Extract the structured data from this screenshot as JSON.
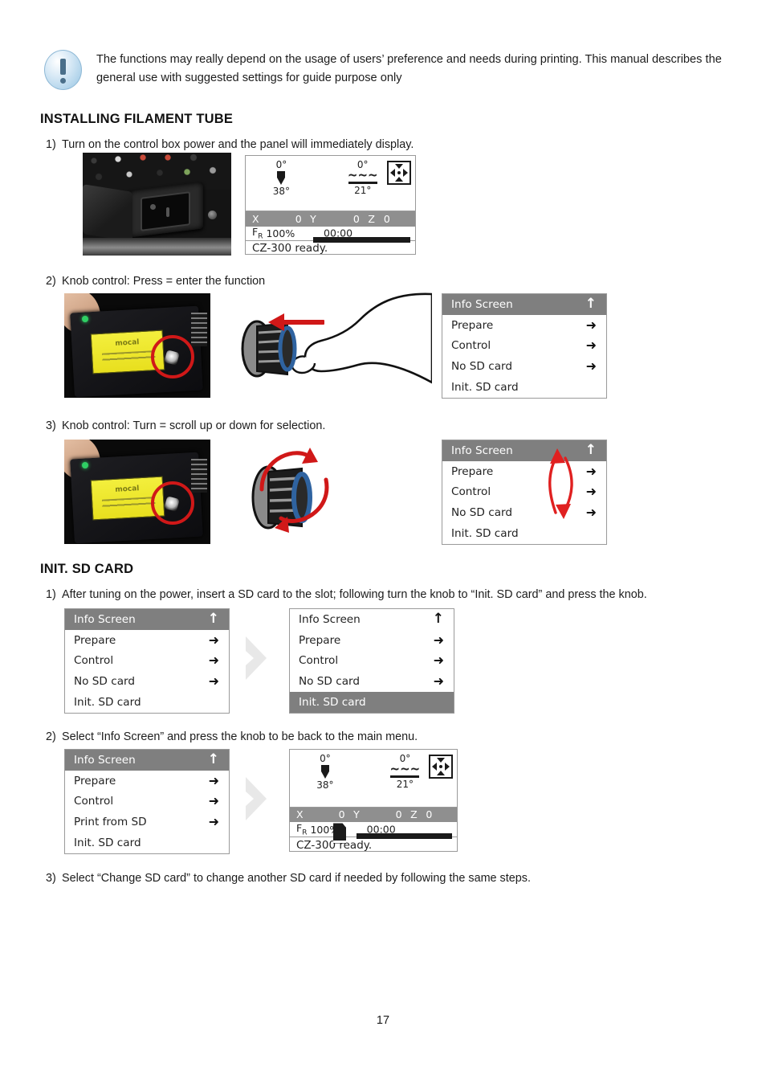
{
  "document": {
    "page_number": "17"
  },
  "notice": {
    "icon": "exclamation-circle-icon",
    "text": "The functions may really depend on the usage of users’ preference and needs during printing. This manual describes the general use with suggested settings for guide purpose only"
  },
  "sections": [
    {
      "heading": "INSTALLING FILAMENT TUBE",
      "steps": [
        {
          "num": "1)",
          "text": "Turn on the control box power and the panel will immediately display."
        },
        {
          "num": "2)",
          "text": "Knob control: Press = enter the function"
        },
        {
          "num": "3)",
          "text": "Knob control: Turn = scroll up or down for selection."
        }
      ]
    },
    {
      "heading": "INIT. SD CARD",
      "steps": [
        {
          "num": "1)",
          "text": "After tuning on the power, insert a SD card to the slot; following turn the knob to “Init. SD card” and press the knob."
        },
        {
          "num": "2)",
          "text": "Select “Info Screen” and press the knob to be back to the main menu."
        },
        {
          "num": "3)",
          "text": "Select “Change SD card” to change another SD card if needed by following the same steps."
        }
      ]
    }
  ],
  "lcd_status_a": {
    "nozzle_target": "0°",
    "nozzle_current": "38°",
    "bed_target": "0°",
    "bed_current": "21°",
    "axis_x_label": "X",
    "axis_x_value": "0",
    "axis_y_label": "Y",
    "axis_y_value": "0",
    "axis_z_label": "Z",
    "axis_z_value": "0",
    "feedrate_label": "F",
    "feedrate_sub": "R",
    "feedrate_value": "100%",
    "elapsed_time": "00:00",
    "status_message": "CZ-300 ready."
  },
  "lcd_status_b": {
    "nozzle_target": "0°",
    "nozzle_current": "38°",
    "bed_target": "0°",
    "bed_current": "21°",
    "axis_x_label": "X",
    "axis_x_value": "0",
    "axis_y_label": "Y",
    "axis_y_value": "0",
    "axis_z_label": "Z",
    "axis_z_value": "0",
    "feedrate_label": "F",
    "feedrate_sub": "R",
    "feedrate_value": "100%",
    "elapsed_time": "00:00",
    "status_message": "CZ-300 ready.",
    "sd_icon": "sd-card-icon"
  },
  "menu_step2": {
    "rows": [
      {
        "label": "Info Screen",
        "arrow": "↑",
        "arrow_kind": "up",
        "selected": true
      },
      {
        "label": "Prepare",
        "arrow": "➜",
        "arrow_kind": "right",
        "selected": false
      },
      {
        "label": "Control",
        "arrow": "➜",
        "arrow_kind": "right",
        "selected": false
      },
      {
        "label": "No SD card",
        "arrow": "➜",
        "arrow_kind": "right",
        "selected": false
      },
      {
        "label": "Init. SD card",
        "arrow": "",
        "arrow_kind": "none",
        "selected": false
      }
    ]
  },
  "menu_step3": {
    "rows": [
      {
        "label": "Info Screen",
        "arrow": "↑",
        "arrow_kind": "up",
        "selected": true
      },
      {
        "label": "Prepare",
        "arrow": "➜",
        "arrow_kind": "right",
        "selected": false
      },
      {
        "label": "Control",
        "arrow": "➜",
        "arrow_kind": "right",
        "selected": false
      },
      {
        "label": "No SD card",
        "arrow": "➜",
        "arrow_kind": "right",
        "selected": false
      },
      {
        "label": "Init. SD card",
        "arrow": "",
        "arrow_kind": "none",
        "selected": false
      }
    ],
    "annotation": "scroll-up-down-arrows"
  },
  "menu_sd_before": {
    "rows": [
      {
        "label": "Info Screen",
        "arrow": "↑",
        "arrow_kind": "up",
        "selected": true
      },
      {
        "label": "Prepare",
        "arrow": "➜",
        "arrow_kind": "right",
        "selected": false
      },
      {
        "label": "Control",
        "arrow": "➜",
        "arrow_kind": "right",
        "selected": false
      },
      {
        "label": "No SD card",
        "arrow": "➜",
        "arrow_kind": "right",
        "selected": false
      },
      {
        "label": "Init. SD card",
        "arrow": "",
        "arrow_kind": "none",
        "selected": false
      }
    ]
  },
  "menu_sd_after": {
    "rows": [
      {
        "label": "Info Screen",
        "arrow": "↑",
        "arrow_kind": "up",
        "selected": false
      },
      {
        "label": "Prepare",
        "arrow": "➜",
        "arrow_kind": "right",
        "selected": false
      },
      {
        "label": "Control",
        "arrow": "➜",
        "arrow_kind": "right",
        "selected": false
      },
      {
        "label": "No SD card",
        "arrow": "➜",
        "arrow_kind": "right",
        "selected": false
      },
      {
        "label": "Init. SD card",
        "arrow": "",
        "arrow_kind": "none",
        "selected": true
      }
    ]
  },
  "menu_sd_back": {
    "rows": [
      {
        "label": "Info Screen",
        "arrow": "↑",
        "arrow_kind": "up",
        "selected": true
      },
      {
        "label": "Prepare",
        "arrow": "➜",
        "arrow_kind": "right",
        "selected": false
      },
      {
        "label": "Control",
        "arrow": "➜",
        "arrow_kind": "right",
        "selected": false
      },
      {
        "label": "Print from SD",
        "arrow": "➜",
        "arrow_kind": "right",
        "selected": false
      },
      {
        "label": "Init. SD card",
        "arrow": "",
        "arrow_kind": "none",
        "selected": false
      }
    ]
  },
  "photos": {
    "power_socket": "control-box-power-socket-photo",
    "panel_press": "control-panel-knob-press-photo",
    "panel_turn": "control-panel-knob-turn-photo",
    "knob_press_drawing": "knob-press-illustration",
    "knob_turn_drawing": "knob-turn-illustration"
  },
  "colors": {
    "menu_header_gray": "#7f7f7f",
    "lcd_axis_gray": "#8f8f8f",
    "annotation_red": "#e02020",
    "chevron_gray": "#e8e8e8",
    "border_gray": "#9a9a9a",
    "knob_blue": "#3a6ea5"
  }
}
